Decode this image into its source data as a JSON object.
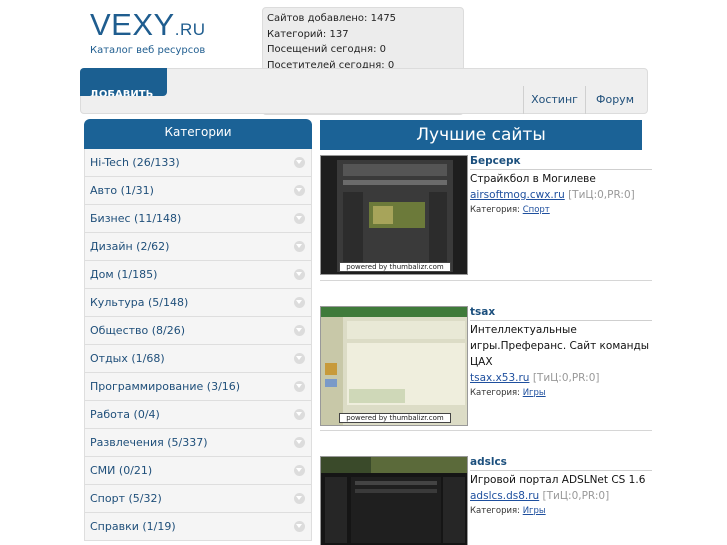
{
  "logo": {
    "main": "VEXY",
    "tld": ".RU",
    "subtitle": "Каталог веб ресурсов"
  },
  "stats": [
    "Сайтов добавлено: 1475",
    "Категорий: 137",
    "Посещений сегодня: 0",
    "Посетителей сегодня: 0"
  ],
  "nav": {
    "add_label": "Добавить",
    "links": [
      "Хостинг",
      "Форум"
    ]
  },
  "categories": {
    "title": "Категории",
    "items": [
      "Hi-Tech (26/133)",
      "Авто (1/31)",
      "Бизнес (11/148)",
      "Дизайн (2/62)",
      "Дом (1/185)",
      "Культура (5/148)",
      "Общество (8/26)",
      "Отдых (1/68)",
      "Программирование (3/16)",
      "Работа (0/4)",
      "Развлечения (5/337)",
      "СМИ (0/21)",
      "Спорт (5/32)",
      "Справки (1/19)"
    ]
  },
  "best": {
    "title": "Лучшие сайты",
    "powered": "powered by thumbalizr.com",
    "category_label": "Категория:",
    "sites": [
      {
        "name": "Берсерк",
        "desc": "Страйкбол в Могилеве",
        "url": "airsoftmog.cwx.ru",
        "meta": "[ТиЦ:0,PR:0]",
        "category": "Спорт"
      },
      {
        "name": "tsax",
        "desc": "Интеллектуальные игры.Преферанс. Сайт команды ЦАХ",
        "url": "tsax.x53.ru",
        "meta": "[ТиЦ:0,PR:0]",
        "category": "Игры"
      },
      {
        "name": "adslcs",
        "desc": "Игровой портал ADSLNet CS 1.6",
        "url": "adslcs.ds8.ru",
        "meta": "[ТиЦ:0,PR:0]",
        "category": "Игры"
      }
    ]
  }
}
